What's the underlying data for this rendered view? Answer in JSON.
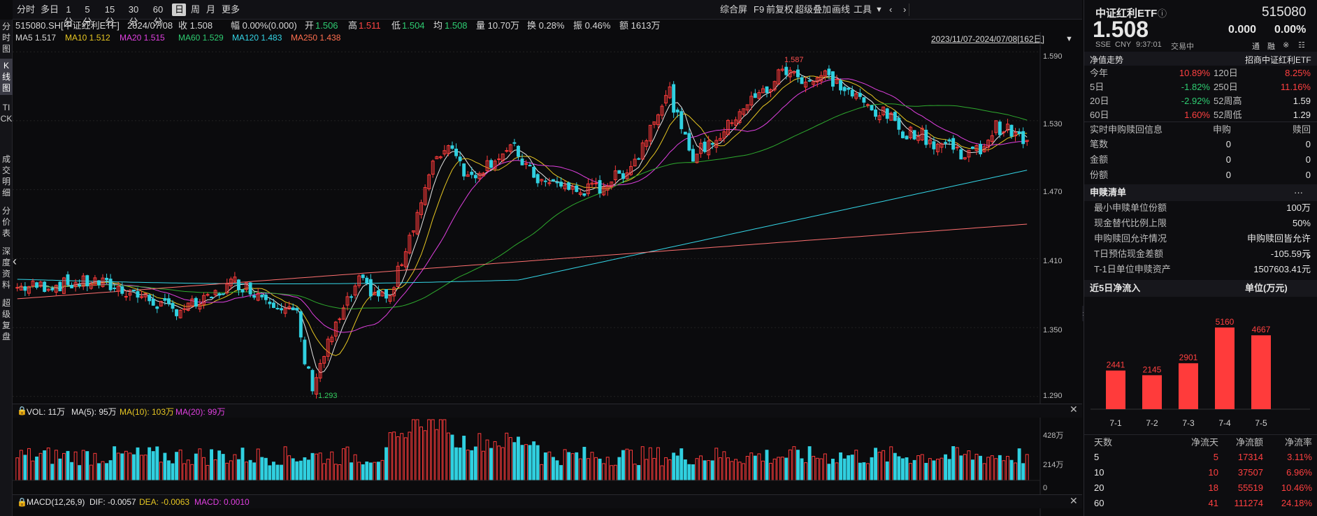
{
  "toolbar": {
    "periods": [
      "分时",
      "多日",
      "1分",
      "5分",
      "15分",
      "30分",
      "60分",
      "日",
      "周",
      "月",
      "更多"
    ],
    "active_period": "日",
    "right_tools": [
      "综合屏",
      "F9",
      "前复权",
      "超级叠加",
      "画线",
      "工具"
    ]
  },
  "side_tabs": [
    "分时图",
    "K线图",
    "TICK",
    "成交明细",
    "分价表",
    "深度资料",
    "超级复盘"
  ],
  "active_side_tab": "K线图",
  "quote_line": {
    "code": "515080.SH[中证红利ETF]",
    "date": "2024/07/08",
    "close": "收 1.508",
    "change": "幅 0.00%(0.000)",
    "open_label": "开",
    "open": "1.506",
    "high_label": "高",
    "high": "1.511",
    "low_label": "低",
    "low": "1.504",
    "avg_label": "均",
    "avg": "1.508",
    "volume": "量 10.70万",
    "turnover": "换 0.28%",
    "amplitude": "振 0.46%",
    "amount": "额 1613万"
  },
  "ma_line": {
    "ma5": "MA5 1.517",
    "ma10": "MA10 1.512",
    "ma20": "MA20 1.515",
    "ma60": "MA60 1.529",
    "ma120": "MA120 1.483",
    "ma250": "MA250 1.438",
    "range": "2023/11/07-2024/07/08[162日]"
  },
  "price_axis": [
    "1.590",
    "1.530",
    "1.470",
    "1.410",
    "1.350",
    "1.290"
  ],
  "price_markers": {
    "high": "1.587",
    "low": "1.293"
  },
  "vol_panel": {
    "vol": "VOL: 11万",
    "ma5": "MA(5): 95万",
    "ma10": "MA(10): 103万",
    "ma20": "MA(20): 99万",
    "axis": [
      "428万",
      "214万",
      "0"
    ]
  },
  "macd_panel": {
    "title": "MACD(12,26,9)",
    "dif": "DIF: -0.0057",
    "dea": "DEA: -0.0063",
    "macd": "MACD: 0.0010"
  },
  "colors": {
    "up": "#ff3b3b",
    "down": "#30d0e0",
    "ma5": "#e6e6e6",
    "ma10": "#e6c622",
    "ma20": "#e040e0",
    "ma60": "#2eaa2e",
    "ma120": "#34d5e6",
    "ma250": "#ff7070"
  },
  "candles_summary": "162 daily bars from 2023/11/07 to 2024/07/08",
  "panel": {
    "name": "中证红利ETF",
    "code": "515080",
    "price": "1.508",
    "change": "0.000",
    "change_pct": "0.00%",
    "exchange": "SSE",
    "currency": "CNY",
    "time": "9:37:01",
    "status": "交易中",
    "mini_icons": [
      "通",
      "融",
      "※",
      "☷"
    ],
    "nav_title": "净值走势",
    "nav_source": "招商中证红利ETF",
    "perf": [
      {
        "l1": "今年",
        "v1": "10.89%",
        "l2": "120日",
        "v2": "8.25%"
      },
      {
        "l1": "5日",
        "v1": "-1.82%",
        "l2": "250日",
        "v2": "11.16%"
      },
      {
        "l1": "20日",
        "v1": "-2.92%",
        "l2": "52周高",
        "v2": "1.59"
      },
      {
        "l1": "60日",
        "v1": "1.60%",
        "l2": "52周低",
        "v2": "1.29"
      }
    ],
    "sub_title": "实时申购赎回信息",
    "sub_headers": [
      "申购",
      "赎回"
    ],
    "sub_rows": [
      {
        "label": "笔数",
        "buy": "0",
        "sell": "0"
      },
      {
        "label": "金额",
        "buy": "0",
        "sell": "0"
      },
      {
        "label": "份额",
        "buy": "0",
        "sell": "0"
      }
    ],
    "list_title": "申赎清单",
    "list_more": "···",
    "list_rows": [
      {
        "label": "最小申赎单位份额",
        "value": "100万"
      },
      {
        "label": "现金替代比例上限",
        "value": "50%"
      },
      {
        "label": "申购赎回允许情况",
        "value": "申购赎回皆允许"
      },
      {
        "label": "T日预估现金差额",
        "value": "-105.59元"
      },
      {
        "label": "T-1日单位申赎资产",
        "value": "1507603.41元"
      }
    ],
    "flow_title": "近5日净流入",
    "flow_unit": "单位(万元)",
    "flow_table_headers": [
      "天数",
      "净流天",
      "净流额",
      "净流率"
    ],
    "flow_table": [
      {
        "days": "5",
        "flow_days": "5",
        "amount": "17314",
        "rate": "3.11%"
      },
      {
        "days": "10",
        "flow_days": "10",
        "amount": "37507",
        "rate": "6.96%"
      },
      {
        "days": "20",
        "flow_days": "18",
        "amount": "55519",
        "rate": "10.46%"
      },
      {
        "days": "60",
        "flow_days": "41",
        "amount": "111274",
        "rate": "24.18%"
      }
    ]
  },
  "chart_data": {
    "type": "bar",
    "title": "近5日净流入",
    "categories": [
      "7-1",
      "7-2",
      "7-3",
      "7-4",
      "7-5"
    ],
    "values": [
      2441,
      2145,
      2901,
      5160,
      4667
    ],
    "ylabel": "单位(万元)"
  }
}
